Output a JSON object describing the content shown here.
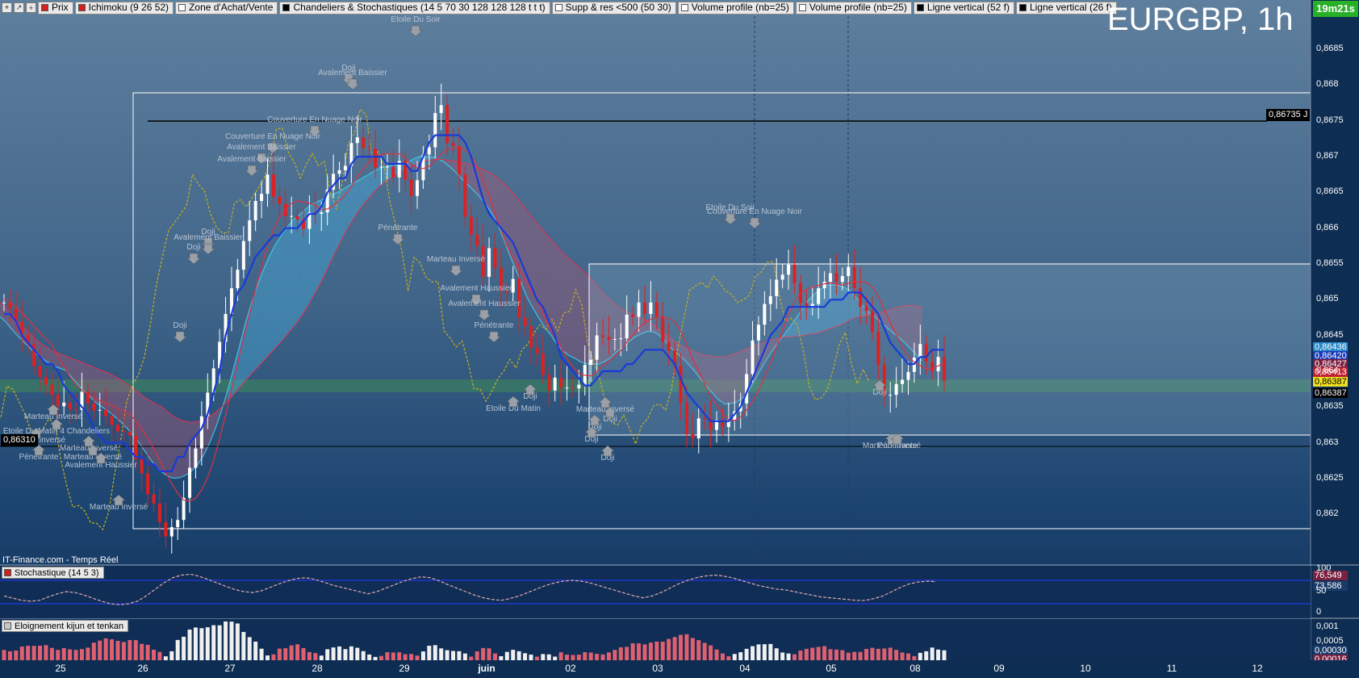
{
  "toolbar": {
    "items": [
      {
        "label": "Prix",
        "color": "#d02020"
      },
      {
        "label": "Ichimoku (9 26 52)",
        "color": "#d02020"
      },
      {
        "label": "Zone d'Achat/Vente",
        "color": "#ffffff"
      },
      {
        "label": "Chandeliers & Stochastiques (14 5 70 30 128 128 128 t t t)",
        "color": "#000000"
      },
      {
        "label": "Supp & res <500 (50 30)",
        "color": "#ffffff"
      },
      {
        "label": "Volume profile (nb=25)",
        "color": "#ffffff"
      },
      {
        "label": "Volume profile (nb=25)",
        "color": "#ffffff"
      },
      {
        "label": "Ligne vertical (52 f)",
        "color": "#000000"
      },
      {
        "label": "Ligne vertical (26 f)",
        "color": "#000000"
      }
    ]
  },
  "chart_title": "EURGBP, 1h",
  "timer": "19m21s",
  "price_labels": {
    "resistance": "0,86735 J",
    "support": "0,86310",
    "right": [
      {
        "text": "0,86436",
        "bg": "#2a8ac8",
        "color": "#ffffff"
      },
      {
        "text": "0,86420",
        "bg": "#1a3ab8",
        "color": "#ffffff"
      },
      {
        "text": "0,86427",
        "bg": "#7a2040",
        "color": "#ffffff"
      },
      {
        "text": "0,86413",
        "bg": "#c02030",
        "color": "#ffffff"
      },
      {
        "text": "0,86387",
        "bg": "#f0e020",
        "color": "#000000"
      },
      {
        "text": "0,86387",
        "bg": "#000000",
        "color": "#ffffff"
      }
    ]
  },
  "watermark": "IT-Finance.com - Temps Réel",
  "stoch_panel": {
    "label": "Stochastique (14 5 3)",
    "values": [
      "76,549",
      "73,586"
    ],
    "ticks": [
      "100",
      "50",
      "0"
    ]
  },
  "eloign_panel": {
    "label": "Eloignement kijun et tenkan",
    "values": [
      "0,001",
      "0,0005",
      "0,00030",
      "0,00016"
    ]
  },
  "pattern_labels": [
    {
      "text": "Etoile Du Soir",
      "x": 515,
      "y": 27
    },
    {
      "text": "Doji",
      "x": 432,
      "y": 87
    },
    {
      "text": "Avalement Baissier",
      "x": 437,
      "y": 93
    },
    {
      "text": "Couverture En Nuage Noir",
      "x": 390,
      "y": 151
    },
    {
      "text": "Couverture En Nuage Noir",
      "x": 338,
      "y": 172
    },
    {
      "text": "Avalement Baissier",
      "x": 324,
      "y": 185
    },
    {
      "text": "Avalement Baissier",
      "x": 312,
      "y": 200
    },
    {
      "text": "Pénétrante",
      "x": 493,
      "y": 285
    },
    {
      "text": "Doji",
      "x": 258,
      "y": 290
    },
    {
      "text": "Avalement Baissier",
      "x": 258,
      "y": 297
    },
    {
      "text": "Doji",
      "x": 240,
      "y": 309
    },
    {
      "text": "Marteau Inversé",
      "x": 565,
      "y": 324
    },
    {
      "text": "Avalement Haussier",
      "x": 590,
      "y": 360
    },
    {
      "text": "Avalement Haussier",
      "x": 600,
      "y": 379
    },
    {
      "text": "Pénétrante",
      "x": 612,
      "y": 406
    },
    {
      "text": "Doji",
      "x": 223,
      "y": 406
    },
    {
      "text": "Doji",
      "x": 657,
      "y": 494
    },
    {
      "text": "Etoile Du Matin",
      "x": 636,
      "y": 509
    },
    {
      "text": "Marteau Inversé",
      "x": 750,
      "y": 510
    },
    {
      "text": "Doji",
      "x": 756,
      "y": 522
    },
    {
      "text": "Doji",
      "x": 737,
      "y": 532
    },
    {
      "text": "Doji",
      "x": 733,
      "y": 547
    },
    {
      "text": "Doji",
      "x": 753,
      "y": 570
    },
    {
      "text": "Etoile Du Soir",
      "x": 905,
      "y": 260
    },
    {
      "text": "Couverture En Nuage Noir",
      "x": 935,
      "y": 265
    },
    {
      "text": "Marteau Inversé",
      "x": 66,
      "y": 519
    },
    {
      "text": "Etoile Du Matin 4 Chandeliers",
      "x": 70,
      "y": 537
    },
    {
      "text": "Marteau Inversé",
      "x": 45,
      "y": 548
    },
    {
      "text": "Marteau Inversé",
      "x": 110,
      "y": 558
    },
    {
      "text": "Pénétrante",
      "x": 48,
      "y": 569
    },
    {
      "text": "Marteau Inversé",
      "x": 115,
      "y": 569
    },
    {
      "text": "Avalement Haussier",
      "x": 125,
      "y": 579
    },
    {
      "text": "Marteau Inversé",
      "x": 147,
      "y": 631
    },
    {
      "text": "Doji",
      "x": 1090,
      "y": 489
    },
    {
      "text": "Marteau Inversé",
      "x": 1105,
      "y": 555
    },
    {
      "text": "Pénétrante",
      "x": 1112,
      "y": 555
    }
  ],
  "chart_data": [
    {
      "type": "candlestick",
      "title": "EURGBP, 1h",
      "ylim": [
        0.86155,
        0.86875
      ],
      "y_ticks": [
        "0,8685",
        "0,868",
        "0,8675",
        "0,867",
        "0,8665",
        "0,866",
        "0,8655",
        "0,865",
        "0,8645",
        "0,864",
        "0,8635",
        "0,863",
        "0,8625",
        "0,862"
      ],
      "x_ticks": [
        "25",
        "26",
        "27",
        "28",
        "29",
        "juin",
        "02",
        "03",
        "04",
        "05",
        "08",
        "09",
        "10",
        "11",
        "12"
      ],
      "horizontal_lines": [
        0.86735,
        0.8631
      ],
      "close_series": [
        0.86496,
        0.86488,
        0.86469,
        0.86451,
        0.86438,
        0.86407,
        0.86392,
        0.86381,
        0.86367,
        0.86351,
        0.86356,
        0.86347,
        0.86346,
        0.86371,
        0.86355,
        0.86345,
        0.86346,
        0.86337,
        0.86325,
        0.86316,
        0.86315,
        0.8631,
        0.86277,
        0.86257,
        0.86228,
        0.86215,
        0.86189,
        0.86169,
        0.86182,
        0.86192,
        0.86223,
        0.86265,
        0.86292,
        0.86337,
        0.8637,
        0.86404,
        0.86441,
        0.8648,
        0.86516,
        0.86542,
        0.86582,
        0.86611,
        0.86638,
        0.86648,
        0.86675,
        0.86644,
        0.86634,
        0.86617,
        0.86617,
        0.86612,
        0.86599,
        0.86622,
        0.8662,
        0.86622,
        0.86654,
        0.86676,
        0.86681,
        0.86687,
        0.86719,
        0.86727,
        0.86712,
        0.86711,
        0.86685,
        0.86686,
        0.86686,
        0.86671,
        0.86694,
        0.86668,
        0.86645,
        0.86667,
        0.86703,
        0.86713,
        0.86761,
        0.86772,
        0.86719,
        0.86715,
        0.86675,
        0.86616,
        0.86591,
        0.86575,
        0.86532,
        0.86572,
        0.86545,
        0.86512,
        0.8651,
        0.86529,
        0.86475,
        0.86463,
        0.86433,
        0.86425,
        0.86395,
        0.86373,
        0.86391,
        0.86377,
        0.86377,
        0.86376,
        0.86381,
        0.86409,
        0.86416,
        0.8645,
        0.86448,
        0.86444,
        0.86445,
        0.86446,
        0.86479,
        0.86476,
        0.86496,
        0.8648,
        0.86496,
        0.86476,
        0.86441,
        0.86429,
        0.86407,
        0.86356,
        0.86312,
        0.86306,
        0.86334,
        0.86333,
        0.86318,
        0.86332,
        0.86322,
        0.86332,
        0.86344,
        0.86355,
        0.86396,
        0.86443,
        0.86465,
        0.86494,
        0.86505,
        0.86528,
        0.86535,
        0.86549,
        0.86523,
        0.86495,
        0.8649,
        0.86494,
        0.86516,
        0.86525,
        0.86537,
        0.86525,
        0.86533,
        0.86546,
        0.86516,
        0.8649,
        0.86484,
        0.86455,
        0.86409,
        0.86366,
        0.86367,
        0.86382,
        0.86388,
        0.86399,
        0.86419,
        0.86438,
        0.86413,
        0.864,
        0.8642,
        0.86387
      ],
      "series": [
        {
          "name": "Ichimoku (9 26 52)"
        },
        {
          "name": "Chandeliers & Stochastiques (14 5 70 30 128 128 128 t t t)"
        }
      ],
      "tenkan_series": [
        0.8648,
        0.8648,
        0.8647,
        0.8645,
        0.8644,
        0.8643,
        0.8642,
        0.8641,
        0.8641,
        0.864,
        0.8638,
        0.8637,
        0.8636,
        0.8635,
        0.8634,
        0.8632,
        0.8631,
        0.863,
        0.863,
        0.863,
        0.863,
        0.8629,
        0.8628,
        0.8628,
        0.8627,
        0.8627,
        0.8626,
        0.8626,
        0.8626,
        0.8628,
        0.8628,
        0.863,
        0.8631,
        0.8632,
        0.8634,
        0.8637,
        0.864,
        0.8645,
        0.8648,
        0.8651,
        0.8652,
        0.8654,
        0.8656,
        0.8657,
        0.8658,
        0.8659,
        0.8659,
        0.866,
        0.866,
        0.866,
        0.8661,
        0.8662,
        0.8662,
        0.8663,
        0.8665,
        0.8666,
        0.8667,
        0.8667,
        0.8669,
        0.867,
        0.867,
        0.867,
        0.867,
        0.867,
        0.8669,
        0.8669,
        0.8669,
        0.8669,
        0.8668,
        0.8668,
        0.867,
        0.8672,
        0.8673,
        0.8673,
        0.8673,
        0.8673,
        0.8673,
        0.8672,
        0.867,
        0.8667,
        0.8664,
        0.8662,
        0.8661,
        0.866,
        0.8659,
        0.8658,
        0.8656,
        0.8654,
        0.8652,
        0.865,
        0.8649,
        0.8647,
        0.8645,
        0.8642,
        0.8641,
        0.864,
        0.8639,
        0.8638,
        0.8638,
        0.8639,
        0.864,
        0.864,
        0.864,
        0.864,
        0.8641,
        0.8641,
        0.8642,
        0.8643,
        0.8643,
        0.8643,
        0.8643,
        0.8642,
        0.8641,
        0.8639,
        0.8637,
        0.8636,
        0.8635,
        0.8634,
        0.8633,
        0.8633,
        0.8633,
        0.8633,
        0.8634,
        0.8635,
        0.8637,
        0.8639,
        0.8641,
        0.8643,
        0.8645,
        0.8646,
        0.8647,
        0.8649,
        0.8649,
        0.8649,
        0.8649,
        0.8649,
        0.8649,
        0.8649,
        0.865,
        0.865,
        0.865,
        0.8651,
        0.8651,
        0.8651,
        0.865,
        0.8649,
        0.8648,
        0.8646,
        0.8644,
        0.8643,
        0.8642,
        0.8641,
        0.8641,
        0.8642,
        0.8642,
        0.8643,
        0.8643,
        0.8643
      ]
    },
    {
      "type": "line",
      "title": "Stochastique (14 5 3)",
      "ylim": [
        0,
        100
      ],
      "levels": [
        70,
        30
      ],
      "y_ticks": [
        "100",
        "50",
        "0"
      ],
      "values": [
        40,
        35,
        30,
        28,
        30,
        38,
        45,
        50,
        48,
        42,
        35,
        28,
        22,
        20,
        22,
        28,
        40,
        55,
        70,
        82,
        88,
        90,
        85,
        78,
        70,
        62,
        55,
        50,
        48,
        52,
        60,
        68,
        75,
        80,
        82,
        78,
        72,
        65,
        60,
        55,
        50,
        45,
        50,
        58,
        66,
        74,
        80,
        84,
        82,
        75,
        66,
        58,
        50,
        42,
        36,
        32,
        30,
        34,
        40,
        48,
        56,
        64,
        70,
        74,
        76,
        74,
        70,
        64,
        58,
        52,
        46,
        40,
        36,
        40,
        48,
        58,
        68,
        76,
        82,
        86,
        88,
        86,
        82,
        76,
        70,
        64,
        60,
        56,
        54,
        50,
        46,
        42,
        38,
        36,
        34,
        32,
        30,
        30,
        34,
        40,
        50,
        60,
        68,
        72,
        74,
        73
      ]
    },
    {
      "type": "bar",
      "title": "Eloignement kijun et tenkan",
      "ylim": [
        0,
        0.0012
      ],
      "y_ticks": [
        "0,001",
        "0,0005"
      ],
      "current": "0,00030"
    }
  ]
}
